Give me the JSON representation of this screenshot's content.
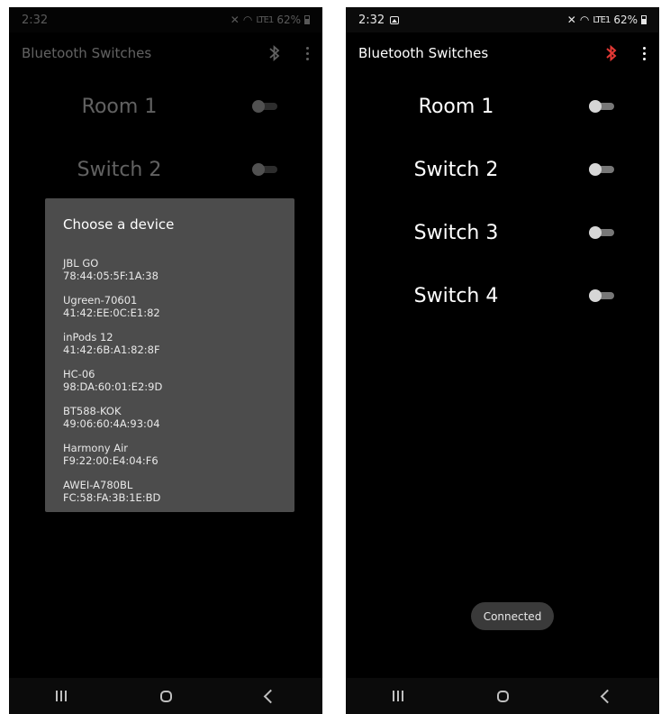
{
  "status": {
    "time": "2:32",
    "battery": "62%",
    "signal_text": "LTE1"
  },
  "app": {
    "title": "Bluetooth Switches",
    "bluetooth_color_left": "#7a7a7a",
    "bluetooth_color_right": "#e53935"
  },
  "switches": [
    {
      "label": "Room 1",
      "checked": false
    },
    {
      "label": "Switch 2",
      "checked": false
    },
    {
      "label": "Switch 3",
      "checked": false
    },
    {
      "label": "Switch 4",
      "checked": false
    }
  ],
  "dialog": {
    "title": "Choose a device",
    "devices": [
      {
        "name": "JBL GO",
        "address": "78:44:05:5F:1A:38"
      },
      {
        "name": "Ugreen-70601",
        "address": "41:42:EE:0C:E1:82"
      },
      {
        "name": "inPods 12",
        "address": "41:42:6B:A1:82:8F"
      },
      {
        "name": "HC-06",
        "address": "98:DA:60:01:E2:9D"
      },
      {
        "name": "BT588-KOK",
        "address": "49:06:60:4A:93:04"
      },
      {
        "name": "Harmony Air",
        "address": "F9:22:00:E4:04:F6"
      },
      {
        "name": "AWEI-A780BL",
        "address": "FC:58:FA:3B:1E:BD"
      }
    ]
  },
  "toast": {
    "text": "Connected"
  },
  "icons": {
    "bluetooth": "bluetooth-icon",
    "menu": "more-vert-icon",
    "gallery": "gallery-icon",
    "battery": "battery-icon",
    "mute": "mute-icon",
    "wifi": "wifi-icon"
  }
}
